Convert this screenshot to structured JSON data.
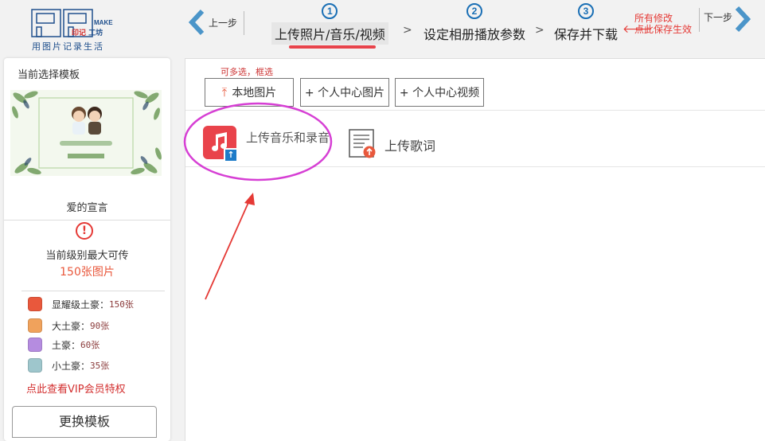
{
  "logo": {
    "letters": "PP",
    "make": "MAKE",
    "sub_red": "印记",
    "sub_blue": "工坊",
    "slogan": "用图片记录生活"
  },
  "nav": {
    "prev_label": "上一步",
    "next_label": "下一步"
  },
  "steps": [
    {
      "num": "1",
      "label": "上传照片/音乐/视频"
    },
    {
      "num": "2",
      "label": "设定相册播放参数"
    },
    {
      "num": "3",
      "label": "保存并下载"
    }
  ],
  "step_separator": ">",
  "save_tip": {
    "line1": "所有修改",
    "line2": "点此保存生效"
  },
  "sidebar": {
    "title": "当前选择模板",
    "template_name": "爱的宣言",
    "level_label": "当前级别最大可传",
    "level_count": "150张图片",
    "tiers": [
      {
        "label": "显耀级土豪：",
        "value": "150张",
        "color": "#e9583c"
      },
      {
        "label": "大土豪：",
        "value": "90张",
        "color": "#f0a25c"
      },
      {
        "label": "土豪：",
        "value": "60张",
        "color": "#b58ce0"
      },
      {
        "label": "小土豪：",
        "value": "35张",
        "color": "#9ec6cc"
      }
    ],
    "vip_link": "点此查看VIP会员特权",
    "change_button": "更换模板"
  },
  "main": {
    "hint": "可多选，框选",
    "buttons": {
      "local": "本地图片",
      "personal_images": "+ 个人中心图片",
      "personal_videos": "+ 个人中心视频"
    },
    "upload_music": "上传音乐和录音",
    "upload_lyrics": "上传歌词"
  },
  "colors": {
    "accent_blue": "#1a6fb5",
    "accent_red": "#e8434b",
    "annotation_magenta": "#d63fd4"
  }
}
